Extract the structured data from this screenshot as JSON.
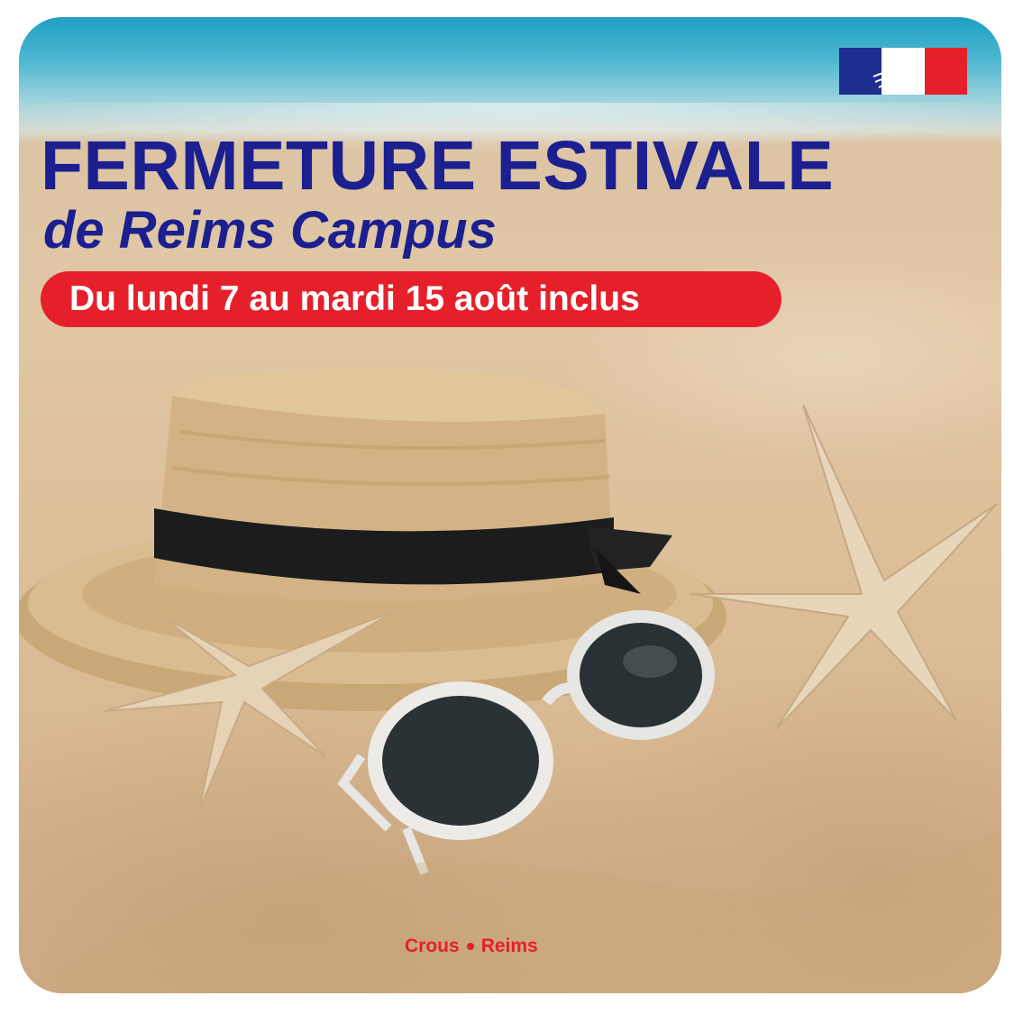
{
  "title": "FERMETURE ESTIVALE",
  "subtitle": "de Reims Campus",
  "dates": "Du lundi 7 au mardi 15 août inclus",
  "footer": {
    "left": "Crous",
    "right": "Reims"
  },
  "logo_icon": "french-republic-marianne-logo",
  "colors": {
    "title_blue": "#1b1f8f",
    "accent_red": "#e5202b",
    "flag_blue": "#1d2e8f"
  }
}
